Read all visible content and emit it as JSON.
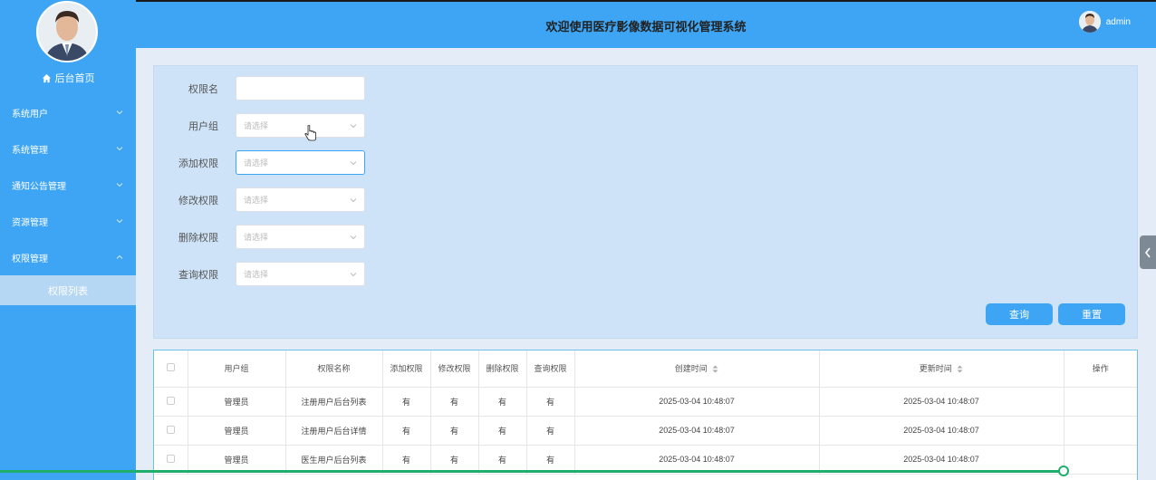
{
  "header": {
    "title": "欢迎使用医疗影像数据可视化管理系统",
    "username": "admin"
  },
  "sidebar": {
    "home": "后台首页",
    "items": [
      {
        "label": "系统用户",
        "icon": "chevron-down-icon"
      },
      {
        "label": "系统管理",
        "icon": "chevron-down-icon"
      },
      {
        "label": "通知公告管理",
        "icon": "chevron-down-icon"
      },
      {
        "label": "资源管理",
        "icon": "chevron-down-icon"
      },
      {
        "label": "权限管理",
        "icon": "chevron-up-icon"
      }
    ],
    "subitem": "权限列表"
  },
  "filter": {
    "fields": [
      {
        "label": "权限名",
        "type": "input",
        "value": ""
      },
      {
        "label": "用户组",
        "type": "select",
        "placeholder": "请选择"
      },
      {
        "label": "添加权限",
        "type": "select",
        "placeholder": "请选择"
      },
      {
        "label": "修改权限",
        "type": "select",
        "placeholder": "请选择"
      },
      {
        "label": "删除权限",
        "type": "select",
        "placeholder": "请选择"
      },
      {
        "label": "查询权限",
        "type": "select",
        "placeholder": "请选择"
      }
    ],
    "search_button": "查询",
    "reset_button": "重置"
  },
  "table": {
    "columns": [
      "用户组",
      "权限名称",
      "添加权限",
      "修改权限",
      "删除权限",
      "查询权限",
      "创建时间",
      "更新时间",
      "操作"
    ],
    "rows": [
      [
        "管理员",
        "注册用户后台列表",
        "有",
        "有",
        "有",
        "有",
        "2025-03-04 10:48:07",
        "2025-03-04 10:48:07",
        ""
      ],
      [
        "管理员",
        "注册用户后台详情",
        "有",
        "有",
        "有",
        "有",
        "2025-03-04 10:48:07",
        "2025-03-04 10:48:07",
        ""
      ],
      [
        "管理员",
        "医生用户后台列表",
        "有",
        "有",
        "有",
        "有",
        "2025-03-04 10:48:07",
        "2025-03-04 10:48:07",
        ""
      ]
    ]
  },
  "colors": {
    "primary": "#3da5f4",
    "panel": "#cfe3f8",
    "progress": "#1fae6b"
  }
}
